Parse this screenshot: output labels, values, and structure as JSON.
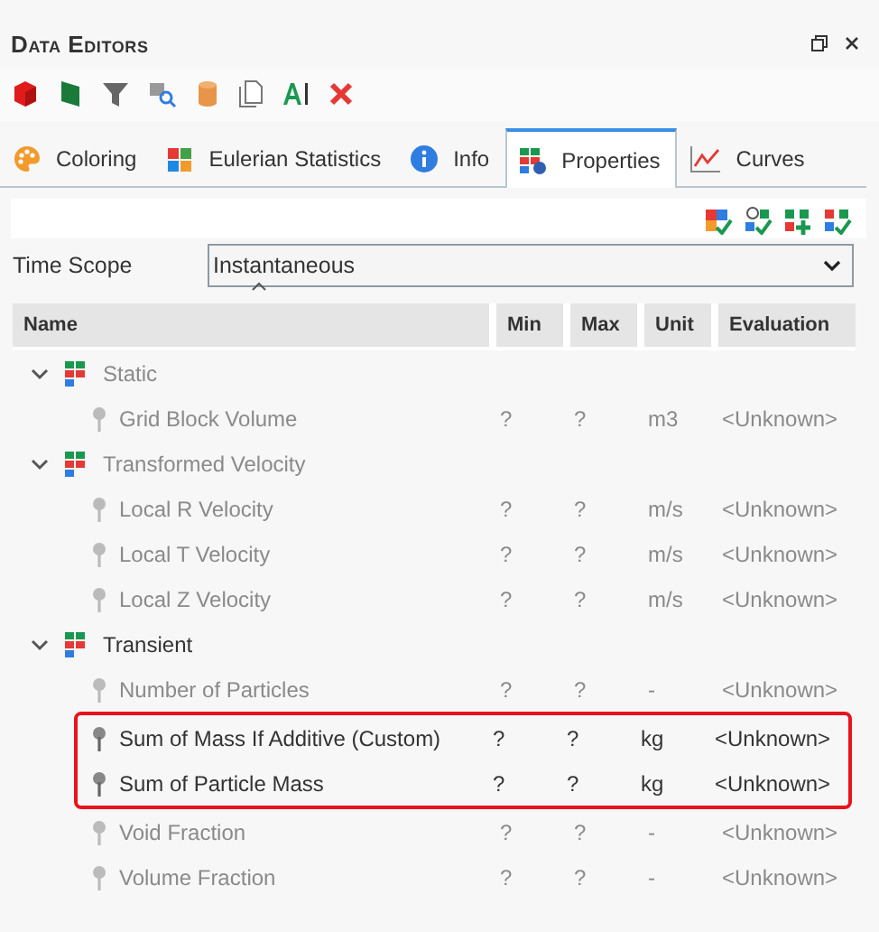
{
  "window": {
    "title": "Data Editors"
  },
  "tabs": [
    {
      "label": "Coloring",
      "selected": false
    },
    {
      "label": "Eulerian Statistics",
      "selected": false
    },
    {
      "label": "Info",
      "selected": false
    },
    {
      "label": "Properties",
      "selected": true
    },
    {
      "label": "Curves",
      "selected": false
    }
  ],
  "time_scope": {
    "label": "Time Scope",
    "value": "Instantaneous"
  },
  "table": {
    "columns": [
      "Name",
      "Min",
      "Max",
      "Unit",
      "Evaluation"
    ],
    "groups": [
      {
        "label": "Static",
        "expanded": true,
        "dimmed": true,
        "children": [
          {
            "name": "Grid Block Volume",
            "min": "?",
            "max": "?",
            "unit": "m3",
            "evaluation": "<Unknown>",
            "dimmed": true,
            "highlighted": false
          }
        ]
      },
      {
        "label": "Transformed Velocity",
        "expanded": true,
        "dimmed": true,
        "children": [
          {
            "name": "Local R Velocity",
            "min": "?",
            "max": "?",
            "unit": "m/s",
            "evaluation": "<Unknown>",
            "dimmed": true,
            "highlighted": false
          },
          {
            "name": "Local T Velocity",
            "min": "?",
            "max": "?",
            "unit": "m/s",
            "evaluation": "<Unknown>",
            "dimmed": true,
            "highlighted": false
          },
          {
            "name": "Local Z Velocity",
            "min": "?",
            "max": "?",
            "unit": "m/s",
            "evaluation": "<Unknown>",
            "dimmed": true,
            "highlighted": false
          }
        ]
      },
      {
        "label": "Transient",
        "expanded": true,
        "dimmed": false,
        "children": [
          {
            "name": "Number of Particles",
            "min": "?",
            "max": "?",
            "unit": "-",
            "evaluation": "<Unknown>",
            "dimmed": true,
            "highlighted": false
          },
          {
            "name": "Sum of Mass If Additive (Custom)",
            "min": "?",
            "max": "?",
            "unit": "kg",
            "evaluation": "<Unknown>",
            "dimmed": false,
            "highlighted": true
          },
          {
            "name": "Sum of Particle Mass",
            "min": "?",
            "max": "?",
            "unit": "kg",
            "evaluation": "<Unknown>",
            "dimmed": false,
            "highlighted": true
          },
          {
            "name": "Void Fraction",
            "min": "?",
            "max": "?",
            "unit": "-",
            "evaluation": "<Unknown>",
            "dimmed": true,
            "highlighted": false
          },
          {
            "name": "Volume Fraction",
            "min": "?",
            "max": "?",
            "unit": "-",
            "evaluation": "<Unknown>",
            "dimmed": true,
            "highlighted": false
          }
        ]
      }
    ]
  }
}
